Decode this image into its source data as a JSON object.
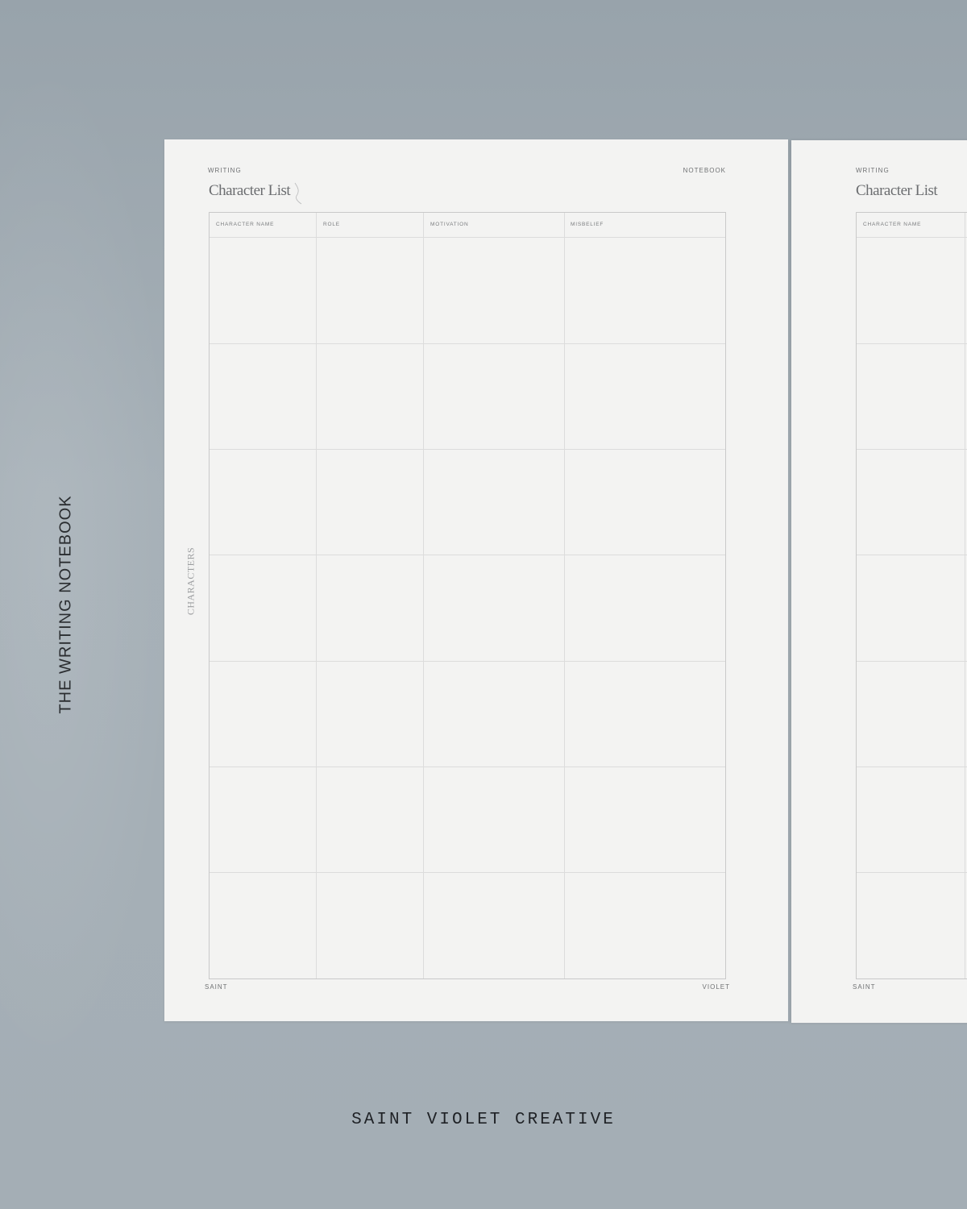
{
  "side_title": "THE WRITING NOTEBOOK",
  "brand": "SAINT VIOLET CREATIVE",
  "left_page": {
    "header_left": "WRITING",
    "header_right": "NOTEBOOK",
    "title": "Character List",
    "side_label": "CHARACTERS",
    "columns": [
      "CHARACTER NAME",
      "ROLE",
      "MOTIVATION",
      "MISBELIEF"
    ],
    "footer_left": "SAINT",
    "footer_right": "VIOLET"
  },
  "right_page": {
    "header_left": "WRITING",
    "title": "Character List",
    "columns": [
      "CHARACTER NAME"
    ],
    "footer_left": "SAINT"
  },
  "colors": {
    "background": "#a3adb4",
    "paper": "#f3f3f2",
    "grid_line": "#dcdcdc",
    "text_dark": "#1f2226"
  }
}
